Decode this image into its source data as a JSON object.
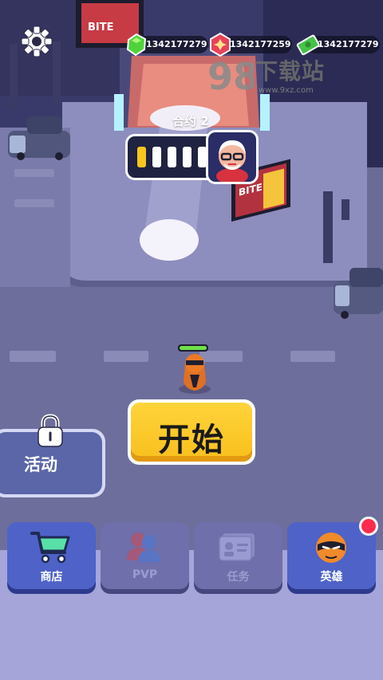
{
  "currencies": [
    {
      "icon": "green-gem-icon",
      "value": "1342177279"
    },
    {
      "icon": "red-shuriken-token-icon",
      "value": "1342177259"
    },
    {
      "icon": "cash-icon",
      "value": "1342177279"
    }
  ],
  "watermark": {
    "logo_text": "下载站",
    "url": "www.9xz.com"
  },
  "scene": {
    "billboard_text": "BITE"
  },
  "contract": {
    "label": "合约 2",
    "slots": [
      "filled",
      "empty",
      "empty",
      "empty",
      "empty"
    ],
    "target_icon": "boss-portrait-icon"
  },
  "player": {
    "health_fraction": 1.0
  },
  "start_button": {
    "label": "开始"
  },
  "events_button": {
    "label": "活动",
    "locked": true
  },
  "nav": [
    {
      "id": "shop",
      "label": "商店",
      "icon": "shopping-cart-icon",
      "enabled": true
    },
    {
      "id": "pvp",
      "label": "PVP",
      "icon": "users-icon",
      "enabled": false
    },
    {
      "id": "tasks",
      "label": "任务",
      "icon": "id-card-icon",
      "enabled": false
    },
    {
      "id": "heroes",
      "label": "英雄",
      "icon": "ninja-head-icon",
      "enabled": true,
      "notification": true
    }
  ],
  "colors": {
    "accent_yellow": "#f8c61f",
    "nav_enabled": "#5063c4",
    "nav_disabled": "#6e6fa8",
    "notification": "#ff2c4d"
  }
}
